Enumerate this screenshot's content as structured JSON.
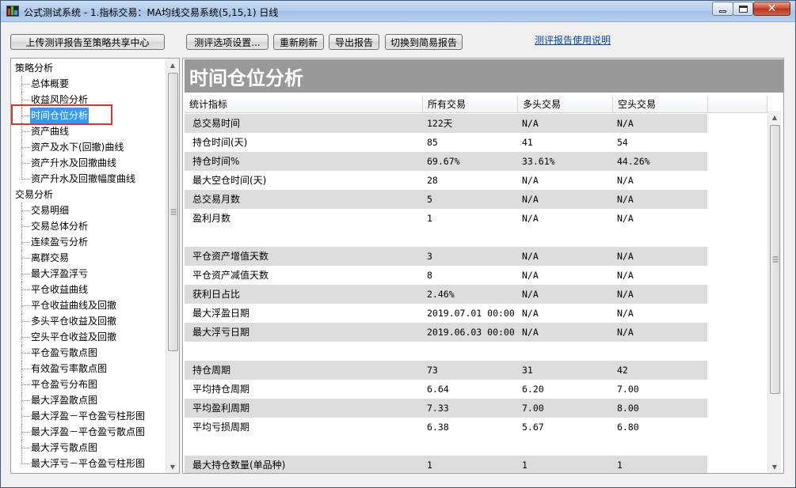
{
  "window": {
    "title": "公式测试系统 - 1.指标交易：MA均线交易系统(5,15,1) 日线"
  },
  "toolbar": {
    "upload_label": "上传测评报告至策略共享中心",
    "options_label": "测评选项设置...",
    "refresh_label": "重新刷新",
    "export_label": "导出报告",
    "simple_label": "切换到简易报告",
    "help_link": "测评报告使用说明"
  },
  "tree": {
    "groups": [
      {
        "label": "策略分析",
        "items": [
          "总体概要",
          "收益风险分析",
          "时间仓位分析",
          "资产曲线",
          "资产及水下(回撤)曲线",
          "资产升水及回撤曲线",
          "资产升水及回撤幅度曲线"
        ]
      },
      {
        "label": "交易分析",
        "items": [
          "交易明细",
          "交易总体分析",
          "连续盈亏分析",
          "离群交易",
          "最大浮盈浮亏",
          "平仓收益曲线",
          "平仓收益曲线及回撤",
          "多头平仓收益及回撤",
          "空头平仓收益及回撤",
          "平仓盈亏散点图",
          "有效盈亏率散点图",
          "平仓盈亏分布图",
          "最大浮盈散点图",
          "最大浮盈－平仓盈亏柱形图",
          "最大浮盈－平仓盈亏散点图",
          "最大浮亏散点图",
          "最大浮亏－平仓盈亏柱形图"
        ]
      }
    ],
    "selected": "时间仓位分析"
  },
  "report": {
    "title": "时间仓位分析",
    "columns": [
      "统计指标",
      "所有交易",
      "多头交易",
      "空头交易"
    ],
    "rows": [
      {
        "name": "总交易时间",
        "all": "122天",
        "long": "N/A",
        "short": "N/A",
        "gray": true
      },
      {
        "name": "持仓时间(天)",
        "all": "85",
        "long": "41",
        "short": "54",
        "gray": false
      },
      {
        "name": "持仓时间%",
        "all": "69.67%",
        "long": "33.61%",
        "short": "44.26%",
        "gray": true
      },
      {
        "name": "最大空仓时间(天)",
        "all": "28",
        "long": "N/A",
        "short": "N/A",
        "gray": false
      },
      {
        "name": "总交易月数",
        "all": "5",
        "long": "N/A",
        "short": "N/A",
        "gray": true
      },
      {
        "name": "盈利月数",
        "all": "1",
        "long": "N/A",
        "short": "N/A",
        "gray": false
      },
      {
        "name": "",
        "all": "",
        "long": "",
        "short": "",
        "gray": false
      },
      {
        "name": "平仓资产增值天数",
        "all": "3",
        "long": "N/A",
        "short": "N/A",
        "gray": true
      },
      {
        "name": "平仓资产减值天数",
        "all": "8",
        "long": "N/A",
        "short": "N/A",
        "gray": false
      },
      {
        "name": "获利日占比",
        "all": "2.46%",
        "long": "N/A",
        "short": "N/A",
        "gray": true
      },
      {
        "name": "最大浮盈日期",
        "all": "2019.07.01 00:00",
        "long": "N/A",
        "short": "N/A",
        "gray": false
      },
      {
        "name": "最大浮亏日期",
        "all": "2019.06.03 00:00",
        "long": "N/A",
        "short": "N/A",
        "gray": true
      },
      {
        "name": "",
        "all": "",
        "long": "",
        "short": "",
        "gray": false
      },
      {
        "name": "持仓周期",
        "all": "73",
        "long": "31",
        "short": "42",
        "gray": true
      },
      {
        "name": "平均持仓周期",
        "all": "6.64",
        "long": "6.20",
        "short": "7.00",
        "gray": false
      },
      {
        "name": "平均盈利周期",
        "all": "7.33",
        "long": "7.00",
        "short": "8.00",
        "gray": true
      },
      {
        "name": "平均亏损周期",
        "all": "6.38",
        "long": "5.67",
        "short": "6.80",
        "gray": false
      },
      {
        "name": "",
        "all": "",
        "long": "",
        "short": "",
        "gray": false
      },
      {
        "name": "最大持仓数量(单品种)",
        "all": "1",
        "long": "1",
        "short": "1",
        "gray": true
      }
    ]
  }
}
